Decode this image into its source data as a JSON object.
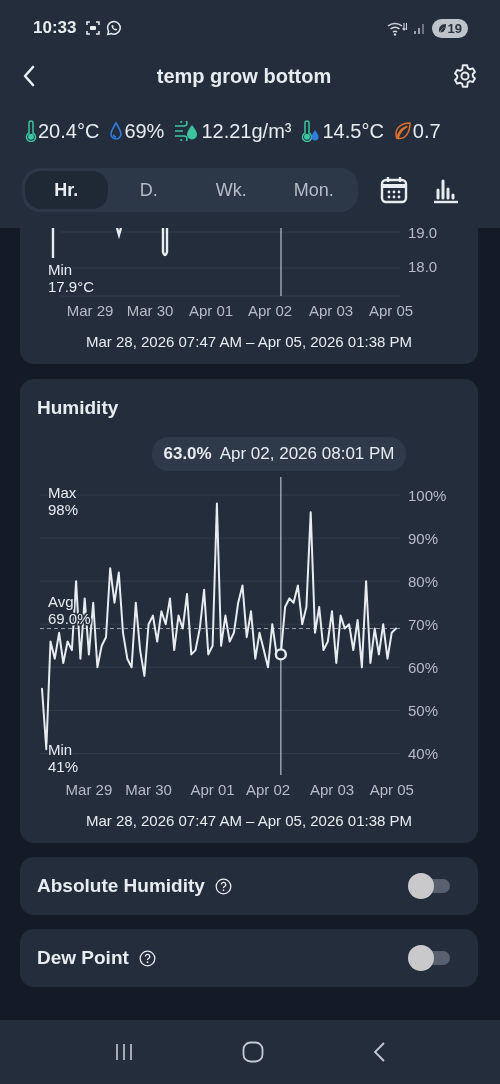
{
  "status_bar": {
    "time": "10:33",
    "battery": "19"
  },
  "header": {
    "title": "temp grow bottom"
  },
  "readings": [
    {
      "kind": "temperature",
      "value": "20.4°C"
    },
    {
      "kind": "humidity",
      "value": "69%"
    },
    {
      "kind": "absolute_humidity",
      "value": "12.21g/m³"
    },
    {
      "kind": "dew_point",
      "value": "14.5°C"
    },
    {
      "kind": "vpd",
      "value": "0.7"
    }
  ],
  "tabs": [
    {
      "label": "Hr.",
      "selected": true
    },
    {
      "label": "D.",
      "selected": false
    },
    {
      "label": "Wk.",
      "selected": false
    },
    {
      "label": "Mon.",
      "selected": false
    }
  ],
  "temperature_card": {
    "y_ticks": [
      "19.0",
      "18.0"
    ],
    "min_label": "Min",
    "min_value": "17.9°C",
    "x_labels": [
      "Mar 29",
      "Mar 30",
      "Apr 01",
      "Apr 02",
      "Apr 03",
      "Apr 05"
    ],
    "range": "Mar 28, 2026 07:47 AM – Apr 05, 2026 01:38 PM"
  },
  "humidity_card": {
    "title": "Humidity",
    "tooltip": {
      "value": "63.0%",
      "time": "Apr 02, 2026 08:01 PM"
    },
    "stats": [
      {
        "label": "Max",
        "value": "98%"
      },
      {
        "label": "Avg",
        "value": "69.0%"
      },
      {
        "label": "Min",
        "value": "41%"
      }
    ],
    "chart_data": {
      "type": "line",
      "ylim": [
        35,
        100
      ],
      "grid": true,
      "categories": [
        null,
        null,
        null,
        null,
        null,
        null,
        null,
        null,
        null,
        null,
        null,
        "Mar 29",
        null,
        null,
        null,
        null,
        null,
        null,
        null,
        null,
        null,
        null,
        null,
        null,
        null,
        "Mar 30",
        null,
        null,
        null,
        null,
        null,
        null,
        null,
        null,
        null,
        null,
        null,
        null,
        null,
        null,
        "Apr 01",
        null,
        null,
        null,
        null,
        null,
        null,
        null,
        null,
        null,
        null,
        null,
        null,
        "Apr 02",
        null,
        null,
        null,
        null,
        null,
        null,
        null,
        null,
        null,
        null,
        null,
        null,
        null,
        null,
        "Apr 03",
        null,
        null,
        null,
        null,
        null,
        null,
        null,
        null,
        null,
        null,
        null,
        null,
        null,
        "Apr 05",
        null
      ],
      "yticks": [
        {
          "value": 100,
          "label": "100%"
        },
        {
          "value": 90,
          "label": "90%"
        },
        {
          "value": 80,
          "label": "80%"
        },
        {
          "value": 70,
          "label": "70%"
        },
        {
          "value": 60,
          "label": "60%"
        },
        {
          "value": 50,
          "label": "50%"
        },
        {
          "value": 40,
          "label": "40%"
        }
      ],
      "series": [
        {
          "color": "#e8ebef",
          "values": [
            55,
            41,
            66,
            62,
            68,
            61,
            66,
            64,
            80,
            62,
            76,
            63,
            75,
            60,
            65,
            67,
            83,
            75,
            82,
            68,
            62,
            60,
            75,
            64,
            58,
            70,
            72,
            66,
            73,
            70,
            76,
            64,
            72,
            69,
            77,
            63,
            64,
            69,
            78,
            63,
            65,
            98,
            65,
            72,
            66,
            68,
            75,
            79,
            67,
            73,
            62,
            68,
            64,
            60,
            70,
            63,
            63,
            74,
            76,
            75,
            79,
            70,
            74,
            96,
            68,
            74,
            64,
            66,
            73,
            61,
            72,
            69,
            70,
            64,
            71,
            60,
            80,
            61,
            69,
            63,
            70,
            62,
            68,
            69
          ]
        }
      ],
      "ref_lines": [
        {
          "axis": "y",
          "value": 69
        }
      ]
    },
    "range": "Mar 28, 2026 07:47 AM – Apr 05, 2026 01:38 PM"
  },
  "toggles": [
    {
      "label": "Absolute Humidity",
      "on": false
    },
    {
      "label": "Dew Point",
      "on": false
    }
  ]
}
